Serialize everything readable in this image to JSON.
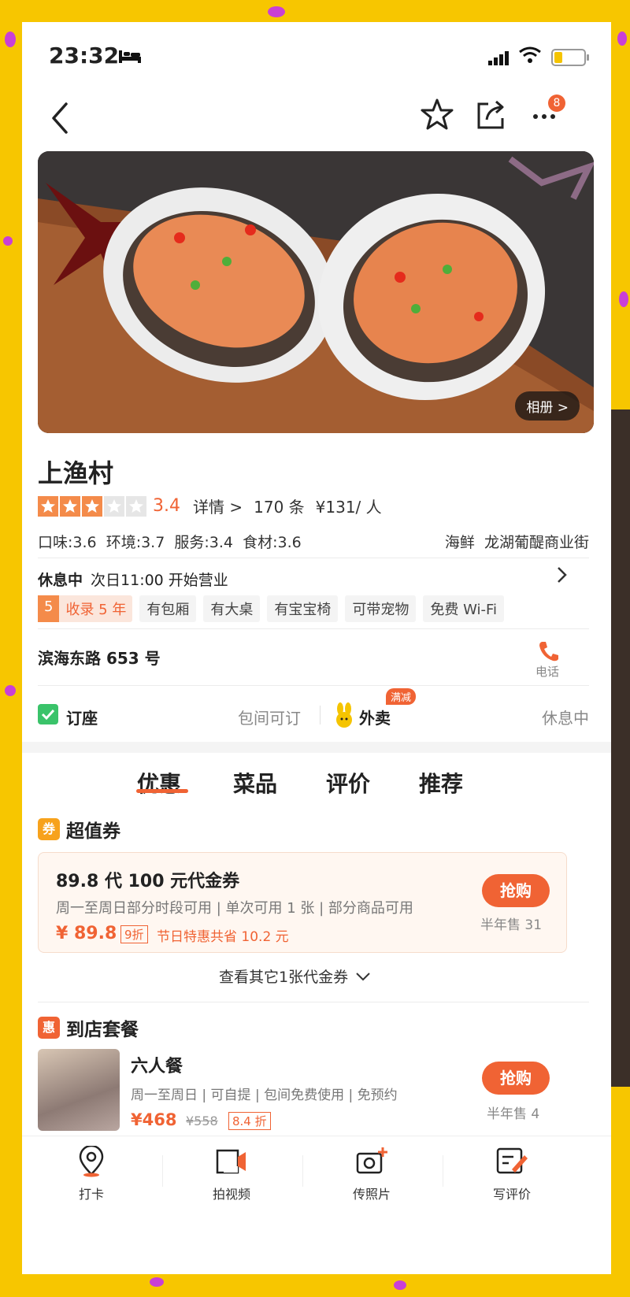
{
  "status_bar": {
    "time": "23:32"
  },
  "nav": {
    "more_badge": "8"
  },
  "hero": {
    "album_label": "相册 >"
  },
  "shop": {
    "name": "上渔村",
    "stars": 3,
    "score": "3.4",
    "details_label": "详情 >",
    "review_count": "170 条",
    "avg_price": "¥131/ 人",
    "sub_scores": "口味:3.6  环境:3.7  服务:3.4  食材:3.6",
    "category_location": "海鲜  龙湖葡醍商业街",
    "status": "休息中",
    "hours": "次日11:00 开始营业",
    "tag_years_num": "5",
    "tag_years_text": "收录 5 年",
    "tags": [
      "有包厢",
      "有大桌",
      "有宝宝椅",
      "可带宠物",
      "免费 Wi-Fi"
    ],
    "address": "滨海东路 653 号",
    "phone_label": "电话"
  },
  "services": {
    "booking_label": "订座",
    "booking_value": "包间可订",
    "delivery_label": "外卖",
    "delivery_badge": "满减",
    "delivery_value": "休息中"
  },
  "tabs": [
    "优惠",
    "菜品",
    "评价",
    "推荐"
  ],
  "vouchers_section": {
    "icon": "券",
    "title": "超值券",
    "item": {
      "title": "89.8 代 100 元代金券",
      "desc": "周一至周日部分时段可用 | 单次可用 1 张 | 部分商品可用",
      "price": "¥ 89.8",
      "discount": "9折",
      "savings": "节日特惠共省 10.2 元",
      "button": "抢购",
      "sold": "半年售 31"
    },
    "more_label": "查看其它1张代金券"
  },
  "package_section": {
    "icon": "惠",
    "title": "到店套餐",
    "item": {
      "name": "六人餐",
      "desc": "周一至周日 | 可自提 | 包间免费使用 | 免预约",
      "price": "¥468",
      "original_price": "¥558",
      "discount": "8.4 折",
      "button": "抢购",
      "sold": "半年售 4"
    }
  },
  "bottom_bar": [
    "打卡",
    "拍视频",
    "传照片",
    "写评价"
  ],
  "colors": {
    "accent": "#f06334",
    "frame": "#f7c600"
  }
}
